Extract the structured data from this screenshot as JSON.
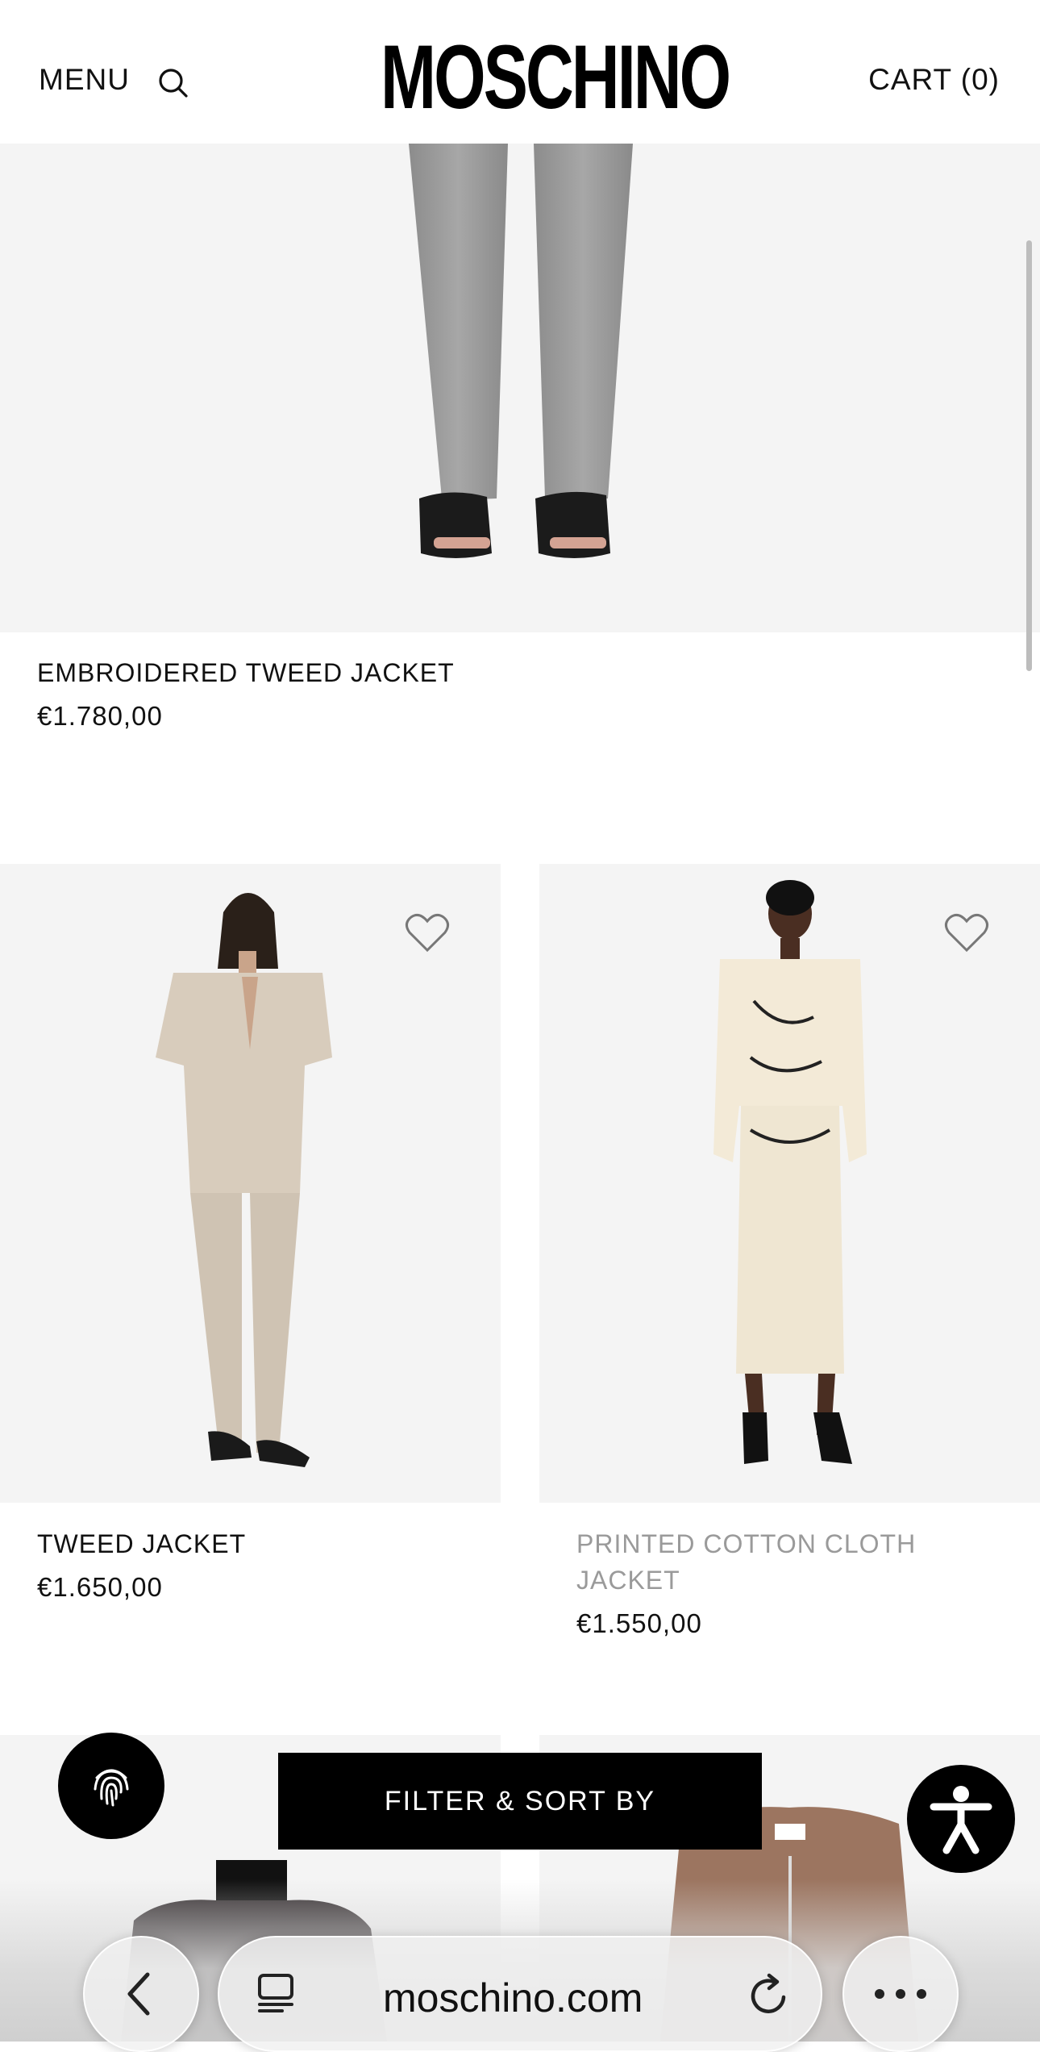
{
  "header": {
    "menu_label": "MENU",
    "brand": "MOSCHINO",
    "cart_label": "CART (0)"
  },
  "products": [
    {
      "name": "EMBROIDERED TWEED JACKET",
      "price": "€1.780,00"
    },
    {
      "name": "TWEED JACKET",
      "price": "€1.650,00"
    },
    {
      "name_line1": "PRINTED COTTON CLOTH",
      "name_line2": "JACKET",
      "price": "€1.550,00",
      "muted": true
    }
  ],
  "controls": {
    "filter_label": "FILTER & SORT BY"
  },
  "browser": {
    "url": "moschino.com"
  },
  "icons": [
    "search-icon",
    "heart-icon",
    "fingerprint-icon",
    "accessibility-icon",
    "back-icon",
    "tabs-icon",
    "reload-icon",
    "more-icon"
  ],
  "colors": {
    "background": "#ffffff",
    "image_bg": "#f4f4f4",
    "text": "#111111",
    "muted_text": "#9a9a9a",
    "button": "#000000"
  }
}
